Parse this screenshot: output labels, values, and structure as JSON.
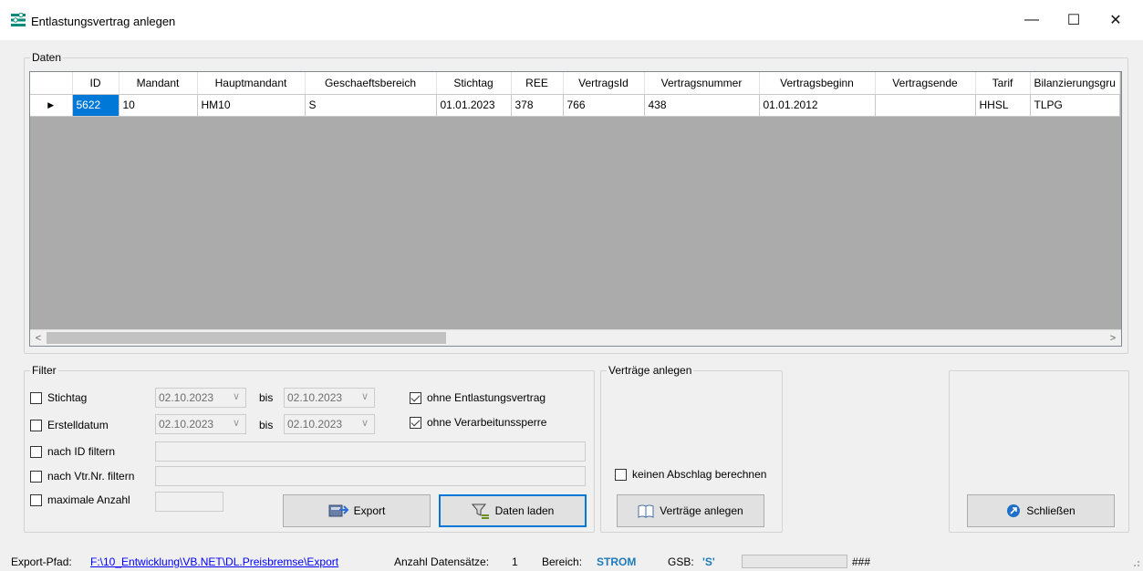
{
  "window": {
    "title": "Entlastungsvertrag anlegen",
    "minimize_glyph": "—",
    "maximize_glyph": "☐",
    "close_glyph": "✕"
  },
  "daten_group": {
    "label": "Daten",
    "columns": [
      "ID",
      "Mandant",
      "Hauptmandant",
      "Geschaeftsbereich",
      "Stichtag",
      "REE",
      "VertragsId",
      "Vertragsnummer",
      "Vertragsbeginn",
      "Vertragsende",
      "Tarif",
      "Bilanzierungsgru"
    ],
    "row": {
      "indicator": "▶",
      "ID": "5622",
      "Mandant": "10",
      "Hauptmandant": "HM10",
      "Geschaeftsbereich": "S",
      "Stichtag": "01.01.2023",
      "REE": "378",
      "VertragsId": "766",
      "Vertragsnummer": "438",
      "Vertragsbeginn": "01.01.2012",
      "Vertragsende": "",
      "Tarif": "HHSL",
      "Bilanzierungsgruppe": "TLPG"
    },
    "scroll_left": "<",
    "scroll_right": ">"
  },
  "filter": {
    "label": "Filter",
    "stichtag": {
      "label": "Stichtag",
      "checked": false,
      "from": "02.10.2023",
      "to": "02.10.2023"
    },
    "erstelldatum": {
      "label": "Erstelldatum",
      "checked": false,
      "from": "02.10.2023",
      "to": "02.10.2023"
    },
    "bis_label": "bis",
    "dropdown_glyph": "∨",
    "ohne_entlastungsvertrag": {
      "label": "ohne Entlastungsvertrag",
      "checked": true
    },
    "ohne_verarbeitungssperre": {
      "label": "ohne Verarbeitunssperre",
      "checked": true
    },
    "nach_id": {
      "label": "nach ID filtern",
      "checked": false,
      "value": ""
    },
    "nach_vtr_nr": {
      "label": "nach Vtr.Nr. filtern",
      "checked": false,
      "value": ""
    },
    "maximale_anzahl": {
      "label": "maximale Anzahl",
      "checked": false,
      "value": ""
    },
    "export_button": "Export",
    "daten_laden_button": "Daten laden"
  },
  "vertraege_group": {
    "label": "Verträge anlegen",
    "keinen_abschlag": {
      "label": "keinen Abschlag berechnen",
      "checked": false
    },
    "vertraege_anlegen_button": "Verträge anlegen"
  },
  "close_panel": {
    "schliessen_button": "Schließen"
  },
  "statusbar": {
    "export_pfad_label": "Export-Pfad:",
    "export_pfad_value": "F:\\10_Entwicklung\\VB.NET\\DL.Preisbremse\\Export",
    "anzahl_label": "Anzahl Datensätze:",
    "anzahl_value": "1",
    "bereich_label": "Bereich:",
    "bereich_value": "STROM",
    "gsb_label": "GSB:",
    "gsb_value": "'S'",
    "hash_text": "###"
  },
  "colors": {
    "selection": "#0078d7",
    "grid_background": "#ababab",
    "link": "#0000ff",
    "status_value": "#1f7ab8"
  }
}
